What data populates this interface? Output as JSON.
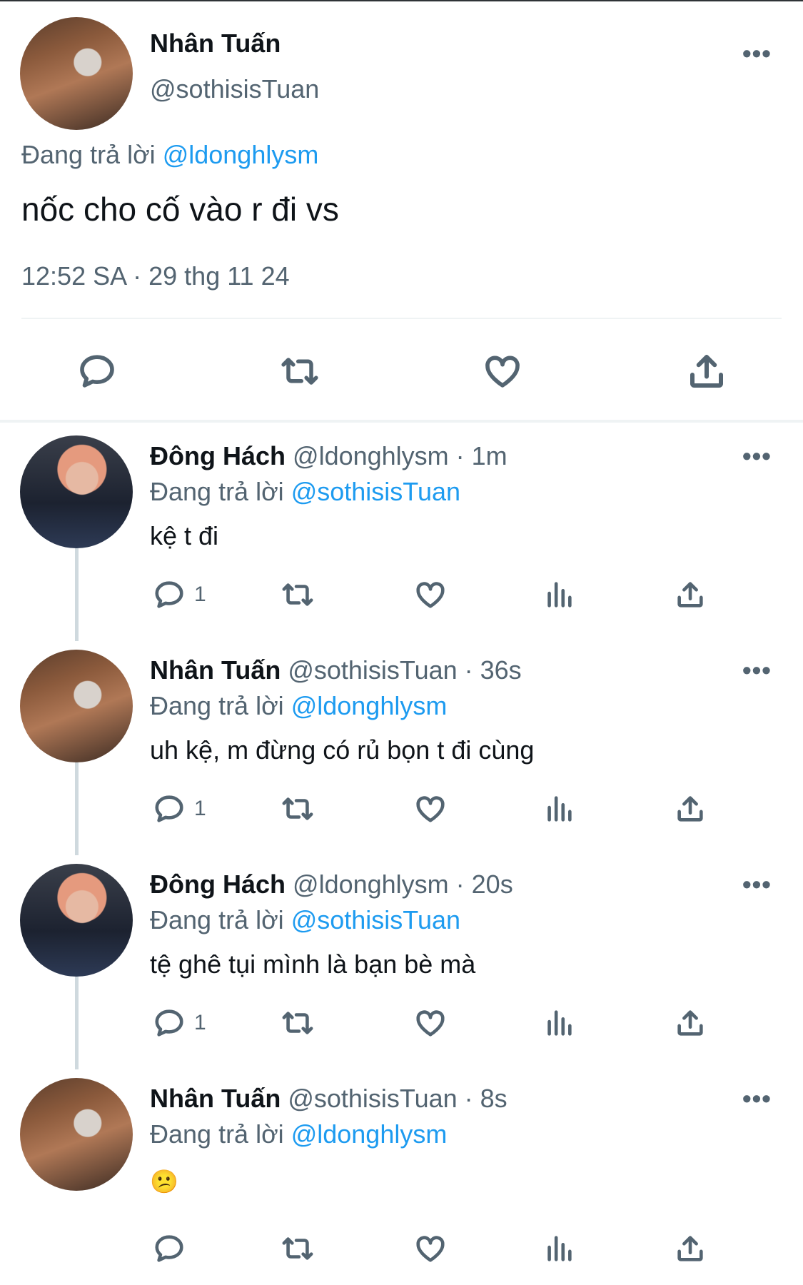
{
  "main_tweet": {
    "name": "Nhân Tuấn",
    "handle": "@sothisisTuan",
    "replying_prefix": "Đang trả lời",
    "replying_to": "@ldonghlysm",
    "text": "nốc cho cố vào r đi vs",
    "timestamp": "12:52 SA · 29 thg 11 24",
    "more_icon": "•••"
  },
  "replies": [
    {
      "name": "Đông Hách",
      "handle": "@ldonghlysm · 1m",
      "replying_prefix": "Đang trả lời",
      "replying_to": "@sothisisTuan",
      "text": "kệ t đi",
      "reply_count": "1"
    },
    {
      "name": "Nhân Tuấn",
      "handle": "@sothisisTuan · 36s",
      "replying_prefix": "Đang trả lời",
      "replying_to": "@ldonghlysm",
      "text": "uh kệ, m đừng có rủ bọn t đi cùng",
      "reply_count": "1"
    },
    {
      "name": "Đông Hách",
      "handle": "@ldonghlysm · 20s",
      "replying_prefix": "Đang trả lời",
      "replying_to": "@sothisisTuan",
      "text": "tệ ghê tụi mình là bạn bè mà",
      "reply_count": "1"
    },
    {
      "name": "Nhân Tuấn",
      "handle": "@sothisisTuan · 8s",
      "replying_prefix": "Đang trả lời",
      "replying_to": "@ldonghlysm",
      "text": "😕",
      "reply_count": ""
    }
  ],
  "icons": {
    "reply": "reply-icon",
    "retweet": "retweet-icon",
    "like": "like-icon",
    "views": "views-icon",
    "share": "share-icon",
    "more": "more-icon"
  },
  "colors": {
    "link": "#1d9bf0",
    "secondary": "#536471",
    "text": "#0f1419"
  }
}
